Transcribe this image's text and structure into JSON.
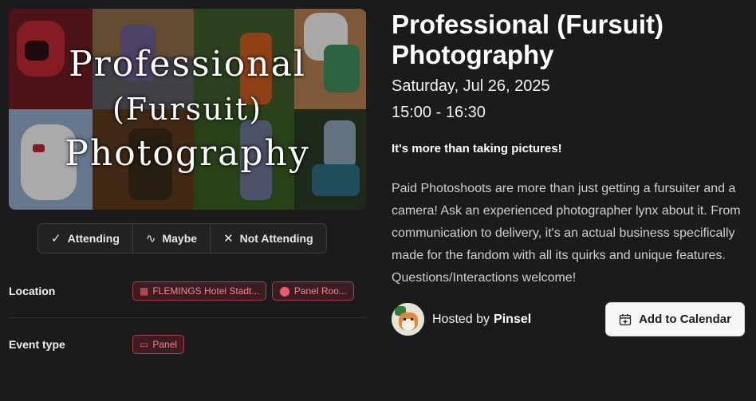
{
  "banner": {
    "lines": [
      "Professional",
      "(Fursuit)",
      "Photography"
    ]
  },
  "rsvp": {
    "attending": {
      "label": "Attending",
      "icon": "check-icon"
    },
    "maybe": {
      "label": "Maybe",
      "icon": "tilde-icon"
    },
    "not_attending": {
      "label": "Not Attending",
      "icon": "x-icon"
    }
  },
  "details": {
    "location_label": "Location",
    "location_chips": [
      {
        "label": "FLEMINGS Hotel Stadt...",
        "icon": "building-icon"
      },
      {
        "label": "Panel Roo...",
        "icon": "map-pin-icon"
      }
    ],
    "event_type_label": "Event type",
    "event_type_chip": {
      "label": "Panel",
      "icon": "id-card-icon"
    }
  },
  "event": {
    "title": "Professional (Fursuit) Photography",
    "date": "Saturday, Jul 26, 2025",
    "time": "15:00 - 16:30",
    "tagline": "It's more than taking pictures!",
    "description": "Paid Photoshoots are more than just getting a fursuiter and a camera! Ask an experienced photographer lynx about it. From communication to delivery, it's an actual business specifically made for the fandom with all its quirks and unique features. Questions/Interactions welcome!"
  },
  "host": {
    "prefix": "Hosted by",
    "name": "Pinsel"
  },
  "calendar_button": {
    "label": "Add to Calendar",
    "icon": "calendar-plus-icon"
  },
  "colors": {
    "background": "#1b1b1d",
    "chip_border": "#a8404c",
    "chip_text": "#f38494",
    "button_bg": "#f7f7f7"
  }
}
